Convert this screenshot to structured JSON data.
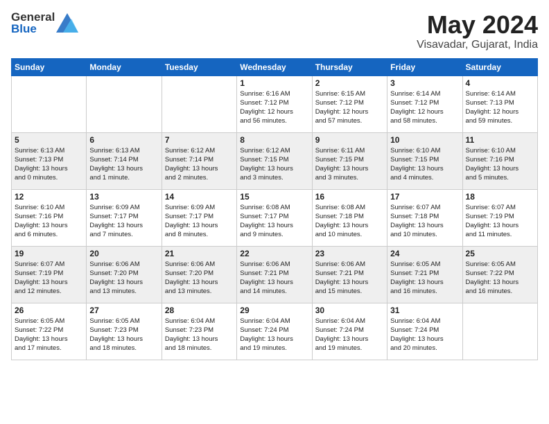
{
  "header": {
    "logo_general": "General",
    "logo_blue": "Blue",
    "month": "May 2024",
    "location": "Visavadar, Gujarat, India"
  },
  "weekdays": [
    "Sunday",
    "Monday",
    "Tuesday",
    "Wednesday",
    "Thursday",
    "Friday",
    "Saturday"
  ],
  "weeks": [
    [
      {
        "day": "",
        "text": ""
      },
      {
        "day": "",
        "text": ""
      },
      {
        "day": "",
        "text": ""
      },
      {
        "day": "1",
        "text": "Sunrise: 6:16 AM\nSunset: 7:12 PM\nDaylight: 12 hours\nand 56 minutes."
      },
      {
        "day": "2",
        "text": "Sunrise: 6:15 AM\nSunset: 7:12 PM\nDaylight: 12 hours\nand 57 minutes."
      },
      {
        "day": "3",
        "text": "Sunrise: 6:14 AM\nSunset: 7:12 PM\nDaylight: 12 hours\nand 58 minutes."
      },
      {
        "day": "4",
        "text": "Sunrise: 6:14 AM\nSunset: 7:13 PM\nDaylight: 12 hours\nand 59 minutes."
      }
    ],
    [
      {
        "day": "5",
        "text": "Sunrise: 6:13 AM\nSunset: 7:13 PM\nDaylight: 13 hours\nand 0 minutes."
      },
      {
        "day": "6",
        "text": "Sunrise: 6:13 AM\nSunset: 7:14 PM\nDaylight: 13 hours\nand 1 minute."
      },
      {
        "day": "7",
        "text": "Sunrise: 6:12 AM\nSunset: 7:14 PM\nDaylight: 13 hours\nand 2 minutes."
      },
      {
        "day": "8",
        "text": "Sunrise: 6:12 AM\nSunset: 7:15 PM\nDaylight: 13 hours\nand 3 minutes."
      },
      {
        "day": "9",
        "text": "Sunrise: 6:11 AM\nSunset: 7:15 PM\nDaylight: 13 hours\nand 3 minutes."
      },
      {
        "day": "10",
        "text": "Sunrise: 6:10 AM\nSunset: 7:15 PM\nDaylight: 13 hours\nand 4 minutes."
      },
      {
        "day": "11",
        "text": "Sunrise: 6:10 AM\nSunset: 7:16 PM\nDaylight: 13 hours\nand 5 minutes."
      }
    ],
    [
      {
        "day": "12",
        "text": "Sunrise: 6:10 AM\nSunset: 7:16 PM\nDaylight: 13 hours\nand 6 minutes."
      },
      {
        "day": "13",
        "text": "Sunrise: 6:09 AM\nSunset: 7:17 PM\nDaylight: 13 hours\nand 7 minutes."
      },
      {
        "day": "14",
        "text": "Sunrise: 6:09 AM\nSunset: 7:17 PM\nDaylight: 13 hours\nand 8 minutes."
      },
      {
        "day": "15",
        "text": "Sunrise: 6:08 AM\nSunset: 7:17 PM\nDaylight: 13 hours\nand 9 minutes."
      },
      {
        "day": "16",
        "text": "Sunrise: 6:08 AM\nSunset: 7:18 PM\nDaylight: 13 hours\nand 10 minutes."
      },
      {
        "day": "17",
        "text": "Sunrise: 6:07 AM\nSunset: 7:18 PM\nDaylight: 13 hours\nand 10 minutes."
      },
      {
        "day": "18",
        "text": "Sunrise: 6:07 AM\nSunset: 7:19 PM\nDaylight: 13 hours\nand 11 minutes."
      }
    ],
    [
      {
        "day": "19",
        "text": "Sunrise: 6:07 AM\nSunset: 7:19 PM\nDaylight: 13 hours\nand 12 minutes."
      },
      {
        "day": "20",
        "text": "Sunrise: 6:06 AM\nSunset: 7:20 PM\nDaylight: 13 hours\nand 13 minutes."
      },
      {
        "day": "21",
        "text": "Sunrise: 6:06 AM\nSunset: 7:20 PM\nDaylight: 13 hours\nand 13 minutes."
      },
      {
        "day": "22",
        "text": "Sunrise: 6:06 AM\nSunset: 7:21 PM\nDaylight: 13 hours\nand 14 minutes."
      },
      {
        "day": "23",
        "text": "Sunrise: 6:06 AM\nSunset: 7:21 PM\nDaylight: 13 hours\nand 15 minutes."
      },
      {
        "day": "24",
        "text": "Sunrise: 6:05 AM\nSunset: 7:21 PM\nDaylight: 13 hours\nand 16 minutes."
      },
      {
        "day": "25",
        "text": "Sunrise: 6:05 AM\nSunset: 7:22 PM\nDaylight: 13 hours\nand 16 minutes."
      }
    ],
    [
      {
        "day": "26",
        "text": "Sunrise: 6:05 AM\nSunset: 7:22 PM\nDaylight: 13 hours\nand 17 minutes."
      },
      {
        "day": "27",
        "text": "Sunrise: 6:05 AM\nSunset: 7:23 PM\nDaylight: 13 hours\nand 18 minutes."
      },
      {
        "day": "28",
        "text": "Sunrise: 6:04 AM\nSunset: 7:23 PM\nDaylight: 13 hours\nand 18 minutes."
      },
      {
        "day": "29",
        "text": "Sunrise: 6:04 AM\nSunset: 7:24 PM\nDaylight: 13 hours\nand 19 minutes."
      },
      {
        "day": "30",
        "text": "Sunrise: 6:04 AM\nSunset: 7:24 PM\nDaylight: 13 hours\nand 19 minutes."
      },
      {
        "day": "31",
        "text": "Sunrise: 6:04 AM\nSunset: 7:24 PM\nDaylight: 13 hours\nand 20 minutes."
      },
      {
        "day": "",
        "text": ""
      }
    ]
  ]
}
